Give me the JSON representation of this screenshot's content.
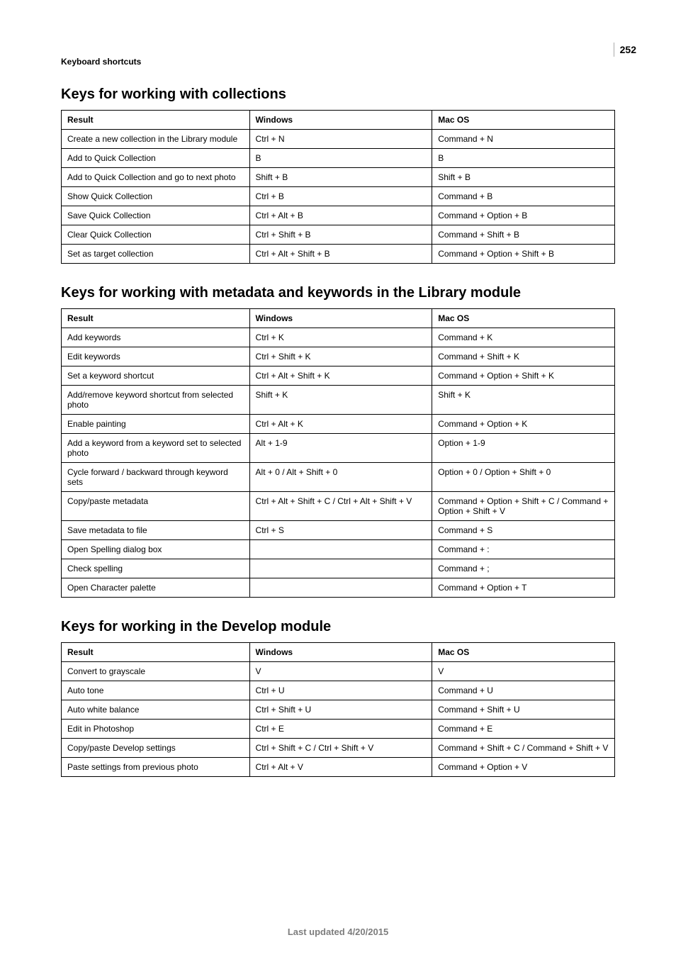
{
  "page_number": "252",
  "section_tag": "Keyboard shortcuts",
  "footer": "Last updated 4/20/2015",
  "columns": {
    "result": "Result",
    "windows": "Windows",
    "macos": "Mac OS"
  },
  "sections": [
    {
      "title": "Keys for working with collections",
      "rows": [
        {
          "result": "Create a new collection in the Library module",
          "windows": "Ctrl + N",
          "macos": "Command + N"
        },
        {
          "result": "Add to Quick Collection",
          "windows": "B",
          "macos": "B"
        },
        {
          "result": "Add to Quick Collection and go to next photo",
          "windows": "Shift + B",
          "macos": "Shift + B"
        },
        {
          "result": "Show Quick Collection",
          "windows": "Ctrl + B",
          "macos": "Command + B"
        },
        {
          "result": "Save Quick Collection",
          "windows": "Ctrl + Alt + B",
          "macos": "Command + Option + B"
        },
        {
          "result": "Clear Quick Collection",
          "windows": "Ctrl + Shift + B",
          "macos": "Command + Shift + B"
        },
        {
          "result": "Set as target collection",
          "windows": "Ctrl + Alt + Shift + B",
          "macos": "Command + Option + Shift + B"
        }
      ]
    },
    {
      "title": "Keys for working with metadata and keywords in the Library module",
      "rows": [
        {
          "result": "Add keywords",
          "windows": "Ctrl + K",
          "macos": "Command + K"
        },
        {
          "result": "Edit keywords",
          "windows": "Ctrl + Shift + K",
          "macos": "Command + Shift + K"
        },
        {
          "result": "Set a keyword shortcut",
          "windows": "Ctrl + Alt + Shift + K",
          "macos": "Command + Option + Shift + K"
        },
        {
          "result": "Add/remove keyword shortcut from selected photo",
          "windows": "Shift + K",
          "macos": "Shift + K"
        },
        {
          "result": "Enable painting",
          "windows": "Ctrl + Alt + K",
          "macos": "Command + Option + K"
        },
        {
          "result": "Add a keyword from a keyword set to selected photo",
          "windows": "Alt + 1-9",
          "macos": "Option + 1-9"
        },
        {
          "result": "Cycle forward / backward through keyword sets",
          "windows": "Alt + 0 / Alt + Shift + 0",
          "macos": "Option + 0 / Option + Shift + 0"
        },
        {
          "result": "Copy/paste metadata",
          "windows": "Ctrl + Alt + Shift + C / Ctrl + Alt + Shift + V",
          "macos": "Command + Option + Shift + C / Command + Option + Shift + V"
        },
        {
          "result": "Save metadata to file",
          "windows": "Ctrl + S",
          "macos": "Command + S"
        },
        {
          "result": "Open Spelling dialog box",
          "windows": "",
          "macos": "Command + :"
        },
        {
          "result": "Check spelling",
          "windows": "",
          "macos": "Command + ;"
        },
        {
          "result": "Open Character palette",
          "windows": "",
          "macos": "Command + Option + T"
        }
      ]
    },
    {
      "title": "Keys for working in the Develop module",
      "rows": [
        {
          "result": "Convert to grayscale",
          "windows": "V",
          "macos": "V"
        },
        {
          "result": "Auto tone",
          "windows": "Ctrl + U",
          "macos": "Command + U"
        },
        {
          "result": "Auto white balance",
          "windows": "Ctrl + Shift + U",
          "macos": "Command + Shift + U"
        },
        {
          "result": "Edit in Photoshop",
          "windows": "Ctrl + E",
          "macos": "Command + E"
        },
        {
          "result": "Copy/paste Develop settings",
          "windows": "Ctrl + Shift + C / Ctrl + Shift + V",
          "macos": "Command + Shift + C / Command + Shift + V"
        },
        {
          "result": "Paste settings from previous photo",
          "windows": "Ctrl + Alt + V",
          "macos": "Command + Option + V"
        }
      ]
    }
  ]
}
